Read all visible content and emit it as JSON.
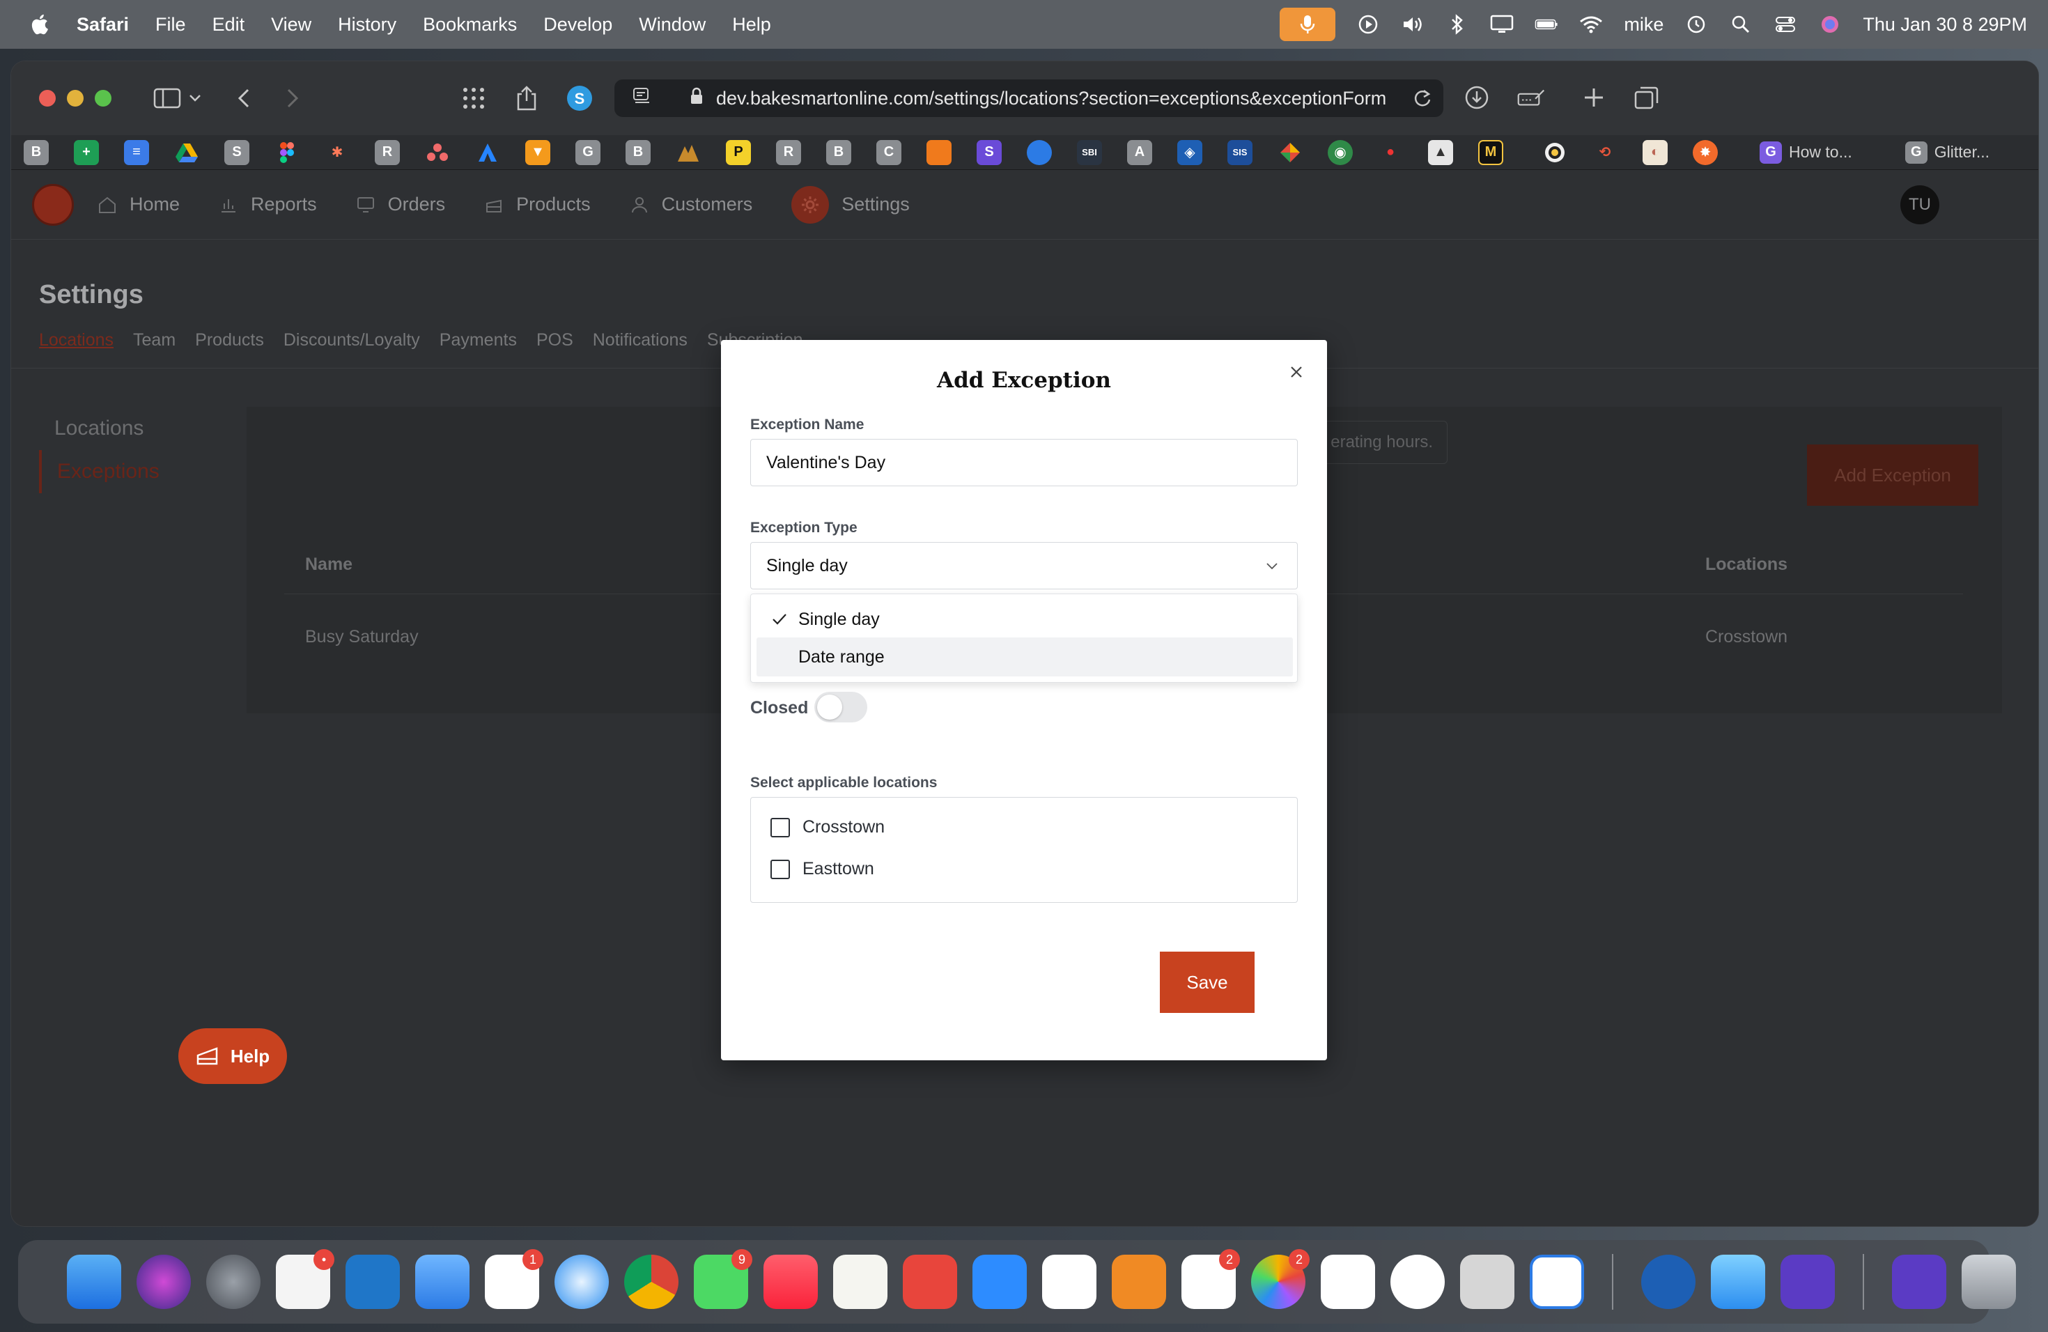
{
  "menubar": {
    "app": "Safari",
    "items": [
      "File",
      "Edit",
      "View",
      "History",
      "Bookmarks",
      "Develop",
      "Window",
      "Help"
    ],
    "user": "mike",
    "clock": "Thu Jan 30  8 29PM"
  },
  "browser": {
    "url": "dev.bakesmartonline.com/settings/locations?section=exceptions&exceptionForm",
    "bookmark_tabs": [
      {
        "label": "How to..."
      },
      {
        "label": "Glitter..."
      }
    ]
  },
  "app": {
    "nav": [
      {
        "label": "Home"
      },
      {
        "label": "Reports"
      },
      {
        "label": "Orders"
      },
      {
        "label": "Products"
      },
      {
        "label": "Customers"
      },
      {
        "label": "Settings"
      }
    ],
    "avatar": "TU",
    "title": "Settings",
    "subtabs": [
      "Locations",
      "Team",
      "Products",
      "Discounts/Loyalty",
      "Payments",
      "POS",
      "Notifications",
      "Subscription"
    ],
    "sidebar": [
      "Locations",
      "Exceptions"
    ],
    "hint": "erating hours.",
    "add_button": "Add Exception",
    "table": {
      "headers": [
        "Name",
        "Locations"
      ],
      "rows": [
        [
          "Busy Saturday",
          "Crosstown"
        ]
      ]
    },
    "help": "Help"
  },
  "modal": {
    "title": "Add Exception",
    "name_label": "Exception Name",
    "name_value": "Valentine's Day",
    "type_label": "Exception Type",
    "type_value": "Single day",
    "options": [
      "Single day",
      "Date range"
    ],
    "closed_label": "Closed",
    "closed": false,
    "locations_label": "Select applicable locations",
    "locations": [
      "Crosstown",
      "Easttown"
    ],
    "save": "Save"
  },
  "colors": {
    "brand": "#c8421f",
    "menubar": "#5b5f64"
  }
}
